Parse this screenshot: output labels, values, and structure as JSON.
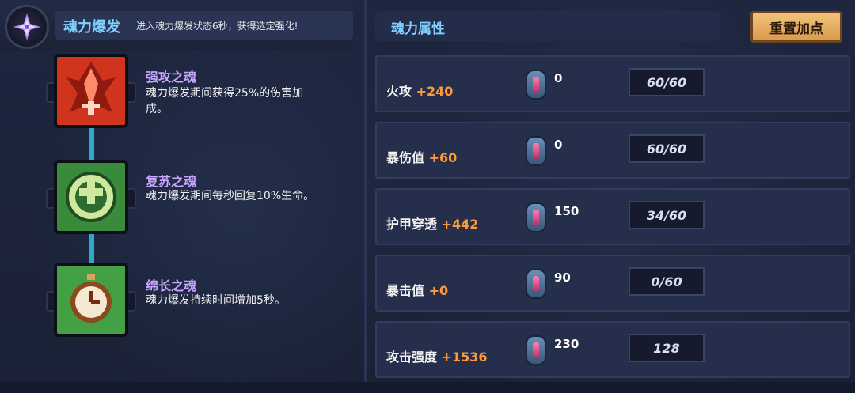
{
  "burst": {
    "title": "魂力爆发",
    "description": "进入魂力爆发状态6秒，获得选定强化!"
  },
  "talents": [
    {
      "name": "强攻之魂",
      "desc_line1": "魂力爆发期间获得25%的伤害加",
      "desc_line2": "成。",
      "icon": "red-crystal-sword-icon"
    },
    {
      "name": "复苏之魂",
      "desc_line1": "魂力爆发期间每秒回复10%生命。",
      "desc_line2": "",
      "icon": "green-heal-cross-icon"
    },
    {
      "name": "绵长之魂",
      "desc_line1": "魂力爆发持续时间增加5秒。",
      "desc_line2": "",
      "icon": "green-stopwatch-icon"
    }
  ],
  "attributes": {
    "title": "魂力属性",
    "reset_label": "重置加点",
    "rows": [
      {
        "name": "火攻",
        "bonus": "+240",
        "cost": "0",
        "level": "60/60"
      },
      {
        "name": "暴伤值",
        "bonus": "+60",
        "cost": "0",
        "level": "60/60"
      },
      {
        "name": "护甲穿透",
        "bonus": "+442",
        "cost": "150",
        "level": "34/60"
      },
      {
        "name": "暴击值",
        "bonus": "+0",
        "cost": "90",
        "level": "0/60"
      },
      {
        "name": "攻击强度",
        "bonus": "+1536",
        "cost": "230",
        "level": "128"
      }
    ]
  },
  "colors": {
    "accent_blue": "#7fd0ff",
    "bonus_orange": "#ff9a3c",
    "talent_name_purple": "#c7a6ff",
    "reset_button": "#e9b066"
  }
}
